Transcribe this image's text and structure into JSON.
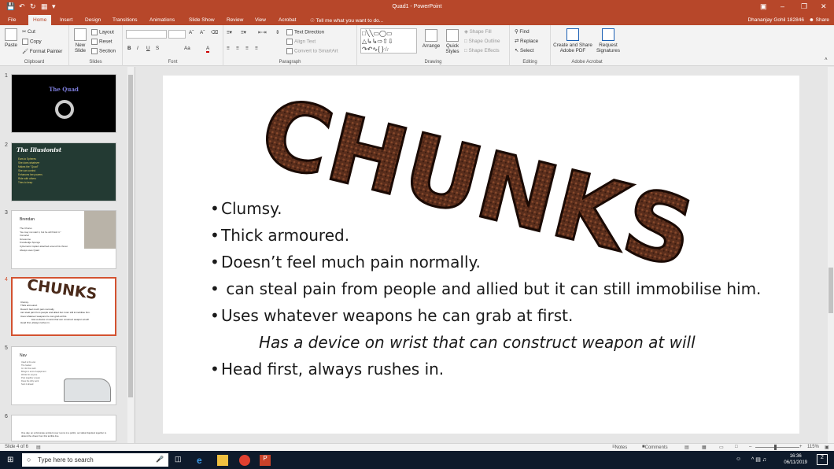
{
  "titlebar": {
    "document_title": "Quad1 - PowerPoint",
    "user_name": "Dhananjay Gohil 182846",
    "share_label": "Share"
  },
  "tabs": [
    "File",
    "Home",
    "Insert",
    "Design",
    "Transitions",
    "Animations",
    "Slide Show",
    "Review",
    "View",
    "Acrobat"
  ],
  "tell_me": "Tell me what you want to do...",
  "ribbon": {
    "clipboard": {
      "paste": "Paste",
      "cut": "Cut",
      "copy": "Copy",
      "format_painter": "Format Painter",
      "label": "Clipboard"
    },
    "slides": {
      "new_slide": "New Slide",
      "layout": "Layout",
      "reset": "Reset",
      "section": "Section",
      "label": "Slides"
    },
    "font": {
      "label": "Font",
      "bold": "B",
      "italic": "I",
      "underline": "U",
      "strike": "S",
      "case": "Aa",
      "font_color": "A"
    },
    "paragraph": {
      "text_direction": "Text Direction",
      "align_text": "Align Text",
      "convert_smartart": "Convert to SmartArt",
      "label": "Paragraph"
    },
    "drawing": {
      "arrange": "Arrange",
      "quick_styles": "Quick Styles",
      "shape_fill": "Shape Fill",
      "shape_outline": "Shape Outline",
      "shape_effects": "Shape Effects",
      "label": "Drawing"
    },
    "editing": {
      "find": "Find",
      "replace": "Replace",
      "select": "Select",
      "label": "Editing"
    },
    "acrobat": {
      "create_share": "Create and Share Adobe PDF",
      "request_sig": "Request Signatures",
      "label": "Adobe Acrobat"
    }
  },
  "thumbnails": [
    {
      "num": "1",
      "title": "The Quad"
    },
    {
      "num": "2",
      "title": "The Illusionist",
      "lines": [
        "The Illusionist",
        "Ears to Spheres",
        "She does whatever",
        "Makes the \"Quad\"",
        "She can control",
        "Enhances her powers",
        "Ride with others",
        "Tries to keep"
      ]
    },
    {
      "num": "3",
      "title": "Brendan",
      "lines": [
        "The Chorus",
        "\"He may not start it, but he will finish it.\"",
        "Immortal",
        "Gruesome",
        "Knowledge Sponge",
        "Cybernetic implant attached around his throat",
        "Always uses Quad"
      ]
    },
    {
      "num": "4",
      "title": "CHUNKS",
      "lines": [
        "Clumsy.",
        "Thick armoured.",
        "Doesn't feel much pain normally.",
        "can steal pain from people and allied but it can still immobilise him.",
        "Uses whatever weapons he can grab at first.",
        "Has a device on wrist that can construct weapon at will",
        "Head first, always rushes in."
      ]
    },
    {
      "num": "5",
      "title": "Nav",
      "lines": [
        "Used to the van",
        "The hacker",
        "In it for the cash",
        "Brings in a lot of equipment",
        "Works for anyone",
        "Puts together a team",
        "Does the dirty work",
        "Sent it ahead"
      ]
    },
    {
      "num": "6",
      "title": "",
      "lines": [
        "One day, an unfortunate accident over rooms in a public, our tallest liquidest together to defend the chaos from this terrible line."
      ]
    }
  ],
  "slide": {
    "title": "CHUNKS",
    "bullets": [
      {
        "text": "Clumsy.",
        "bullet": true,
        "italic": false
      },
      {
        "text": "Thick armoured.",
        "bullet": true,
        "italic": false
      },
      {
        "text": "Doesn’t feel much pain normally.",
        "bullet": true,
        "italic": false
      },
      {
        "text": " can steal pain from people and allied but it can still immobilise him.",
        "bullet": true,
        "italic": false
      },
      {
        "text": "Uses whatever weapons he can grab at first.",
        "bullet": true,
        "italic": false
      },
      {
        "text": "Has a device on wrist that can construct weapon at will",
        "bullet": false,
        "italic": true
      },
      {
        "text": "Head first, always rushes in.",
        "bullet": true,
        "italic": false
      }
    ]
  },
  "status": {
    "slide_info": "Slide 4 of 6",
    "notes": "Notes",
    "comments": "Comments",
    "zoom": "115%"
  },
  "taskbar": {
    "search_placeholder": "Type here to search",
    "time": "16:36",
    "date": "06/11/2019",
    "notif_count": "2"
  },
  "colors": {
    "accent": "#b7472a",
    "taskbar": "#0e1a2b",
    "selection": "#d35230"
  }
}
